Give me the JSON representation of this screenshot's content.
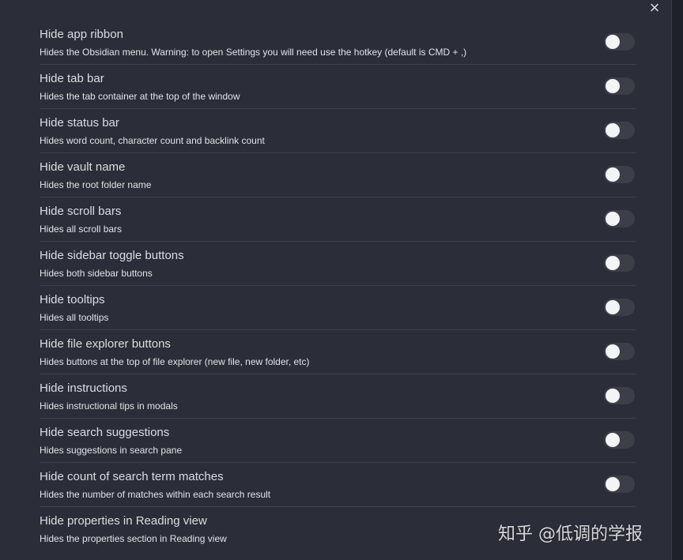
{
  "close_label": "×",
  "settings": [
    {
      "name": "Hide app ribbon",
      "description": "Hides the Obsidian menu. Warning: to open Settings you will need use the hotkey (default is CMD + ,)",
      "enabled": false
    },
    {
      "name": "Hide tab bar",
      "description": "Hides the tab container at the top of the window",
      "enabled": false
    },
    {
      "name": "Hide status bar",
      "description": "Hides word count, character count and backlink count",
      "enabled": false
    },
    {
      "name": "Hide vault name",
      "description": "Hides the root folder name",
      "enabled": false
    },
    {
      "name": "Hide scroll bars",
      "description": "Hides all scroll bars",
      "enabled": false
    },
    {
      "name": "Hide sidebar toggle buttons",
      "description": "Hides both sidebar buttons",
      "enabled": false
    },
    {
      "name": "Hide tooltips",
      "description": "Hides all tooltips",
      "enabled": false
    },
    {
      "name": "Hide file explorer buttons",
      "description": "Hides buttons at the top of file explorer (new file, new folder, etc)",
      "enabled": false
    },
    {
      "name": "Hide instructions",
      "description": "Hides instructional tips in modals",
      "enabled": false
    },
    {
      "name": "Hide search suggestions",
      "description": "Hides suggestions in search pane",
      "enabled": false
    },
    {
      "name": "Hide count of search term matches",
      "description": "Hides the number of matches within each search result",
      "enabled": false
    },
    {
      "name": "Hide properties in Reading view",
      "description": "Hides the properties section in Reading view",
      "enabled": false
    }
  ],
  "watermark": "知乎 @低调的学报"
}
